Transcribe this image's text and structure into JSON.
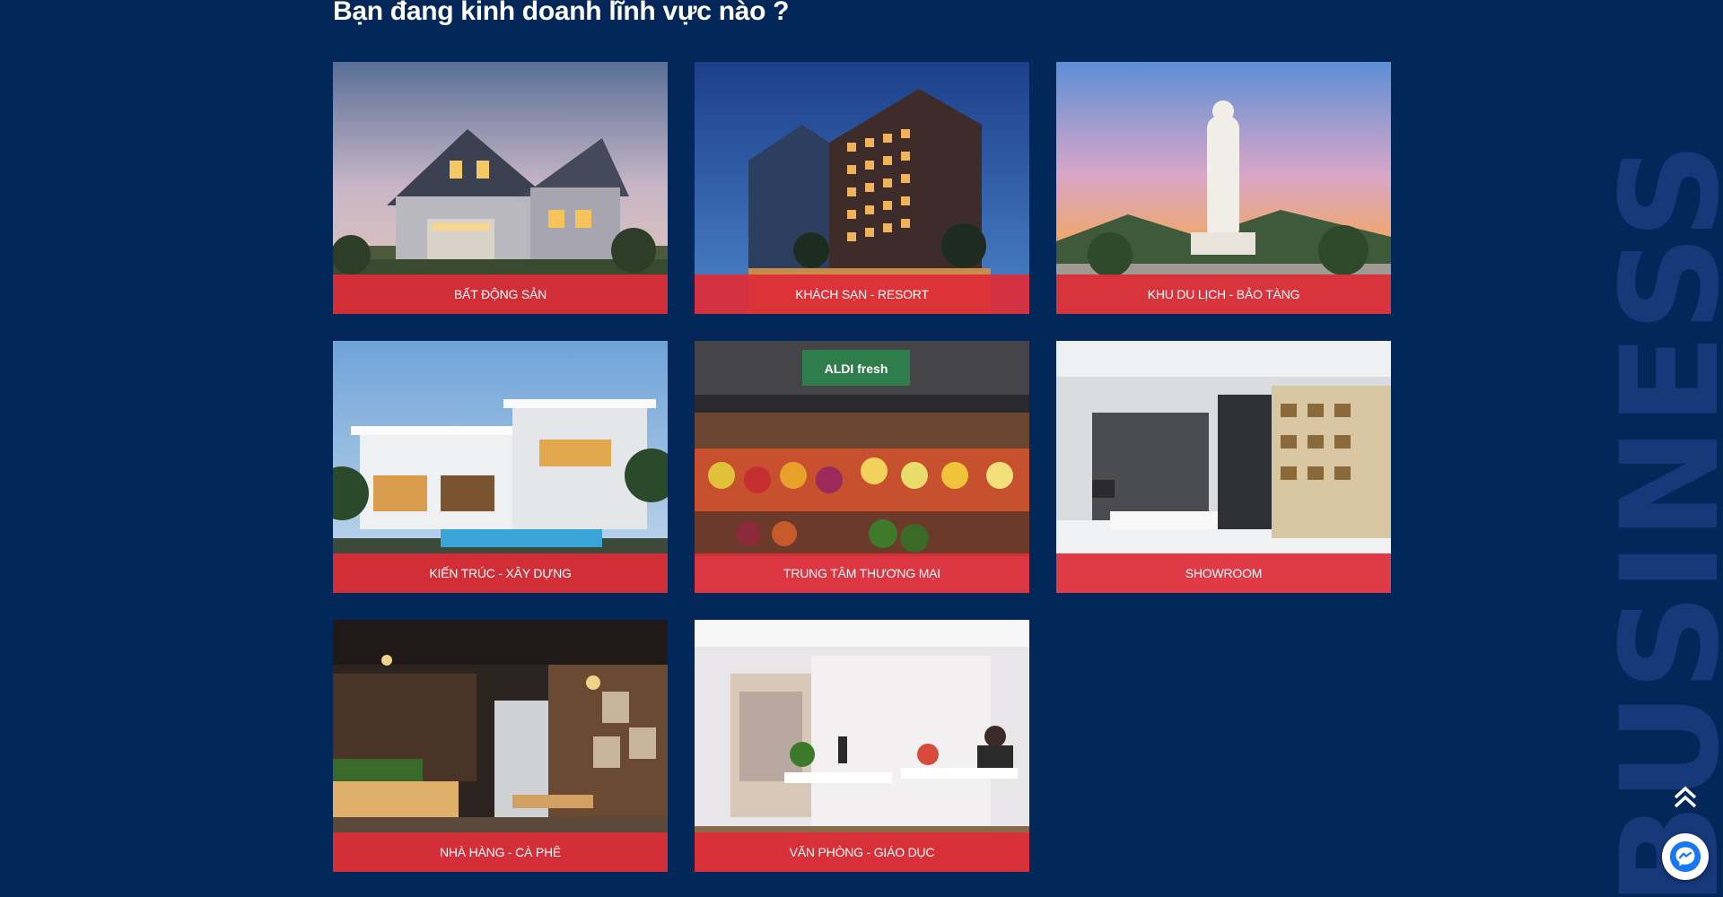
{
  "section": {
    "title": "Bạn đang kinh doanh lĩnh vực nào ?",
    "watermark": "BUSINESS"
  },
  "categories": [
    {
      "label": "BẤT ĐỘNG SẢN",
      "image": "house-photo"
    },
    {
      "label": "KHÁCH SẠN - RESORT",
      "image": "hotel-photo"
    },
    {
      "label": "KHU DU LỊCH - BẢO TÀNG",
      "image": "statue-park-photo"
    },
    {
      "label": "KIẾN TRÚC - XÂY DỰNG",
      "image": "villa-photo"
    },
    {
      "label": "TRUNG TÂM THƯƠNG MẠI",
      "image": "supermarket-photo"
    },
    {
      "label": "SHOWROOM",
      "image": "showroom-photo"
    },
    {
      "label": "NHÀ HÀNG - CÀ PHÊ",
      "image": "cafe-photo"
    },
    {
      "label": "VĂN PHÒNG - GIÁO DỤC",
      "image": "office-photo"
    }
  ],
  "colors": {
    "background": "#04275a",
    "label_bar": "#de2c38",
    "messenger": "#1877f2"
  },
  "icons": {
    "scroll_top": "double-chevron-up-icon",
    "messenger": "messenger-icon"
  }
}
